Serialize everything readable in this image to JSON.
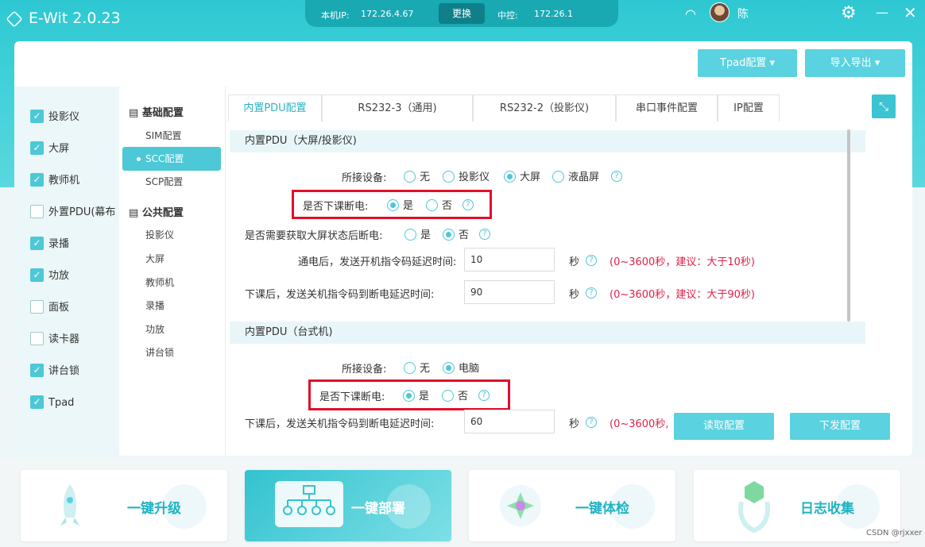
{
  "app": {
    "title": "E-Wit 2.0.23",
    "local_ip_label": "本机IP:",
    "local_ip": "172.26.4.67",
    "change_label": "更换",
    "control_label": "中控:",
    "control_ip": "172.26.1",
    "user_name": "陈"
  },
  "header": {
    "tpad_btn": "Tpad配置 ▾",
    "import_btn": "导入导出 ▾"
  },
  "devices": [
    {
      "label": "投影仪",
      "checked": true
    },
    {
      "label": "大屏",
      "checked": true
    },
    {
      "label": "教师机",
      "checked": true
    },
    {
      "label": "外置PDU(幕布",
      "checked": false
    },
    {
      "label": "录播",
      "checked": true
    },
    {
      "label": "功放",
      "checked": true
    },
    {
      "label": "面板",
      "checked": false
    },
    {
      "label": "读卡器",
      "checked": false
    },
    {
      "label": "讲台锁",
      "checked": true
    },
    {
      "label": "Tpad",
      "checked": true
    }
  ],
  "nav": {
    "group1": "基础配置",
    "group1_items": [
      "SIM配置",
      "SCC配置",
      "SCP配置"
    ],
    "group2": "公共配置",
    "group2_items": [
      "投影仪",
      "大屏",
      "教师机",
      "录播",
      "功放",
      "讲台锁"
    ]
  },
  "tabs": [
    "内置PDU配置",
    "RS232-3（通用)",
    "RS232-2（投影仪)",
    "串口事件配置",
    "IP配置"
  ],
  "section1": {
    "title": "内置PDU（大屏/投影仪)",
    "device_label": "所接设备:",
    "device_options": [
      "无",
      "投影仪",
      "大屏",
      "液晶屏"
    ],
    "poweroff_label": "是否下课断电:",
    "yes": "是",
    "no": "否",
    "status_label": "是否需要获取大屏状态后断电:",
    "poweron_delay_label": "通电后，发送开机指令码延迟时间:",
    "poweron_delay": "10",
    "poweron_hint": "(0~3600秒，建议：大于10秒)",
    "shutdown_delay_label": "下课后，发送关机指令码到断电延迟时间:",
    "shutdown_delay": "90",
    "shutdown_hint": "(0~3600秒，建议：大于90秒)",
    "unit": "秒"
  },
  "section2": {
    "title": "内置PDU（台式机)",
    "device_label": "所接设备:",
    "device_options": [
      "无",
      "电脑"
    ],
    "poweroff_label": "是否下课断电:",
    "yes": "是",
    "no": "否",
    "shutdown_delay_label": "下课后，发送关机指令码到断电延迟时间:",
    "shutdown_delay": "60",
    "shutdown_hint": "(0~3600秒,",
    "unit": "秒"
  },
  "actions": {
    "read": "读取配置",
    "send": "下发配置"
  },
  "cards": [
    "一键升级",
    "一键部署",
    "一键体检",
    "日志收集"
  ],
  "credit": "CSDN @rjxxer",
  "colors": {
    "accent": "#4cc8d6",
    "highlight_box": "#e0102a",
    "hint": "#e0204a"
  }
}
